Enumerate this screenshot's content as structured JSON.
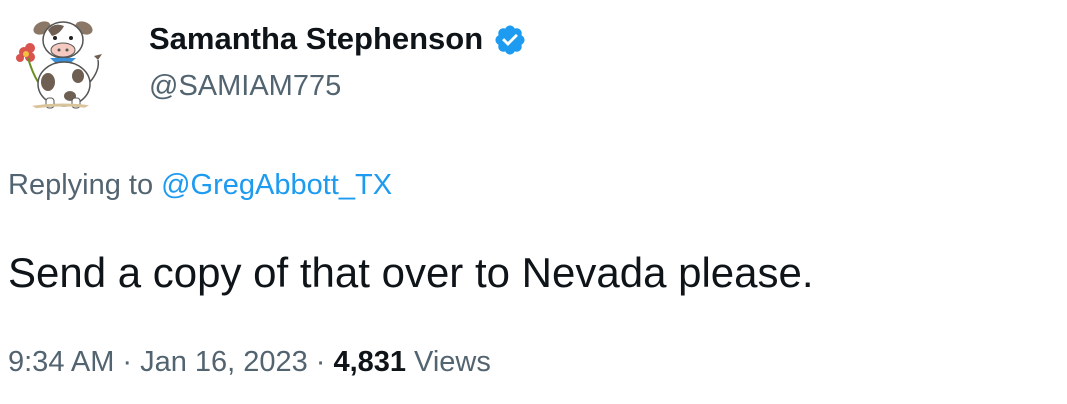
{
  "user": {
    "display_name": "Samantha Stephenson",
    "handle": "@SAMIAM775",
    "avatar_icon": "cow-avatar-icon",
    "verified_icon": "verified-badge-icon",
    "verified_color": "#1d9bf0"
  },
  "reply": {
    "prefix": "Replying to",
    "target": "@GregAbbott_TX"
  },
  "tweet": {
    "text": "Send a copy of that over to Nevada please."
  },
  "meta": {
    "time": "9:34 AM",
    "separator": "·",
    "date": "Jan 16, 2023",
    "views_count": "4,831",
    "views_label": "Views"
  },
  "colors": {
    "text_primary": "#0f1419",
    "text_secondary": "#536471",
    "link": "#1d9bf0"
  }
}
